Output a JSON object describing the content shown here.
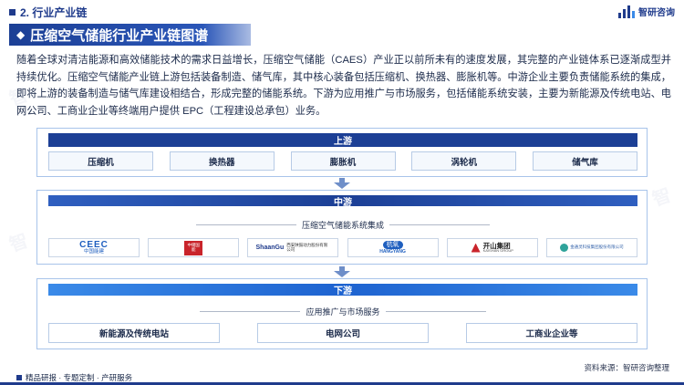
{
  "header": {
    "section_title": "2. 行业产业链",
    "logo_text": "智研咨询"
  },
  "banner": {
    "title": "压缩空气储能行业产业链图谱"
  },
  "intro": "随着全球对清洁能源和高效储能技术的需求日益增长，压缩空气储能（CAES）产业正以前所未有的速度发展，其完整的产业链体系已逐渐成型并持续优化。压缩空气储能产业链上游包括装备制造、储气库，其中核心装备包括压缩机、换热器、膨胀机等。中游企业主要负责储能系统的集成，即将上游的装备制造与储气库建设相结合，形成完整的储能系统。下游为应用推广与市场服务，包括储能系统安装，主要为新能源及传统电站、电网公司、工商业企业等终端用户提供 EPC（工程建设总承包）业务。",
  "upstream": {
    "title": "上游",
    "items": [
      "压缩机",
      "换热器",
      "膨胀机",
      "涡轮机",
      "储气库"
    ]
  },
  "midstream": {
    "title": "中游",
    "subtitle": "压缩空气储能系统集成",
    "companies": [
      {
        "logo_main": "CEEC",
        "logo_sub": "中国能建"
      },
      {
        "logo_main": "中储国能",
        "logo_sub": ""
      },
      {
        "logo_main": "ShaanGu",
        "logo_sub": "西安陕鼓动力股份有限公司"
      },
      {
        "logo_main": "杭氧",
        "logo_sub": "HANGYANG"
      },
      {
        "logo_main": "开山集团",
        "logo_sub": "KAISHAN GROUP"
      },
      {
        "logo_main": "金通灵科技集团股份有限公司",
        "logo_sub": ""
      }
    ]
  },
  "downstream": {
    "title": "下游",
    "subtitle": "应用推广与市场服务",
    "items": [
      "新能源及传统电站",
      "电网公司",
      "工商业企业等"
    ]
  },
  "source": "资料来源：智研咨询整理",
  "footer": {
    "text": "精品研报 · 专题定制 · 产研服务"
  },
  "colors": {
    "brand": "#1f3b8c",
    "stage_head": "#1c3f95",
    "border": "#a8c4ea"
  }
}
